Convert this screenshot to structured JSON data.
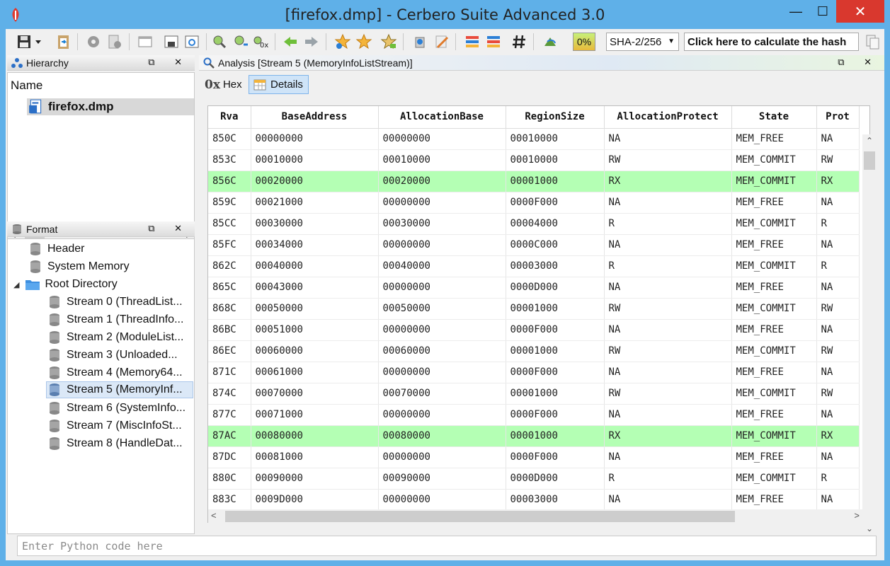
{
  "window": {
    "title": "[firefox.dmp] - Cerbero Suite Advanced 3.0",
    "min": "—",
    "max": "☐",
    "close": "✕"
  },
  "toolbar": {
    "percent": "0%",
    "hash_algo": "SHA-2/256",
    "hash_button": "Click here to calculate the hash"
  },
  "hierarchy": {
    "title": "Hierarchy",
    "column": "Name",
    "item": "firefox.dmp"
  },
  "format": {
    "title": "Format",
    "items": [
      "Header",
      "System Memory",
      "Root Directory",
      "Stream 0 (ThreadList...",
      "Stream 1 (ThreadInfo...",
      "Stream 2 (ModuleList...",
      "Stream 3 (Unloaded...",
      "Stream 4 (Memory64...",
      "Stream 5 (MemoryInf...",
      "Stream 6 (SystemInfo...",
      "Stream 7 (MiscInfoSt...",
      "Stream 8 (HandleDat..."
    ]
  },
  "panel_buttons": "⧉ ✕",
  "analysis": {
    "title": "Analysis [Stream 5 (MemoryInfoListStream)]",
    "tab_hex": "Hex",
    "tab_hex_prefix": "0x",
    "tab_details": "Details"
  },
  "table": {
    "columns": [
      "Rva",
      "BaseAddress",
      "AllocationBase",
      "RegionSize",
      "AllocationProtect",
      "State",
      "Prot"
    ],
    "rows": [
      [
        "850C",
        "00000000",
        "00000000",
        "00010000",
        "NA",
        "MEM_FREE",
        "NA"
      ],
      [
        "853C",
        "00010000",
        "00010000",
        "00010000",
        "RW",
        "MEM_COMMIT",
        "RW"
      ],
      [
        "856C",
        "00020000",
        "00020000",
        "00001000",
        "RX",
        "MEM_COMMIT",
        "RX"
      ],
      [
        "859C",
        "00021000",
        "00000000",
        "0000F000",
        "NA",
        "MEM_FREE",
        "NA"
      ],
      [
        "85CC",
        "00030000",
        "00030000",
        "00004000",
        "R",
        "MEM_COMMIT",
        "R"
      ],
      [
        "85FC",
        "00034000",
        "00000000",
        "0000C000",
        "NA",
        "MEM_FREE",
        "NA"
      ],
      [
        "862C",
        "00040000",
        "00040000",
        "00003000",
        "R",
        "MEM_COMMIT",
        "R"
      ],
      [
        "865C",
        "00043000",
        "00000000",
        "0000D000",
        "NA",
        "MEM_FREE",
        "NA"
      ],
      [
        "868C",
        "00050000",
        "00050000",
        "00001000",
        "RW",
        "MEM_COMMIT",
        "RW"
      ],
      [
        "86BC",
        "00051000",
        "00000000",
        "0000F000",
        "NA",
        "MEM_FREE",
        "NA"
      ],
      [
        "86EC",
        "00060000",
        "00060000",
        "00001000",
        "RW",
        "MEM_COMMIT",
        "RW"
      ],
      [
        "871C",
        "00061000",
        "00000000",
        "0000F000",
        "NA",
        "MEM_FREE",
        "NA"
      ],
      [
        "874C",
        "00070000",
        "00070000",
        "00001000",
        "RW",
        "MEM_COMMIT",
        "RW"
      ],
      [
        "877C",
        "00071000",
        "00000000",
        "0000F000",
        "NA",
        "MEM_FREE",
        "NA"
      ],
      [
        "87AC",
        "00080000",
        "00080000",
        "00001000",
        "RX",
        "MEM_COMMIT",
        "RX"
      ],
      [
        "87DC",
        "00081000",
        "00000000",
        "0000F000",
        "NA",
        "MEM_FREE",
        "NA"
      ],
      [
        "880C",
        "00090000",
        "00090000",
        "0000D000",
        "R",
        "MEM_COMMIT",
        "R"
      ],
      [
        "883C",
        "0009D000",
        "00000000",
        "00003000",
        "NA",
        "MEM_FREE",
        "NA"
      ]
    ],
    "highlight_color": "#b4ffb4"
  },
  "python": {
    "placeholder": "Enter Python code here"
  }
}
